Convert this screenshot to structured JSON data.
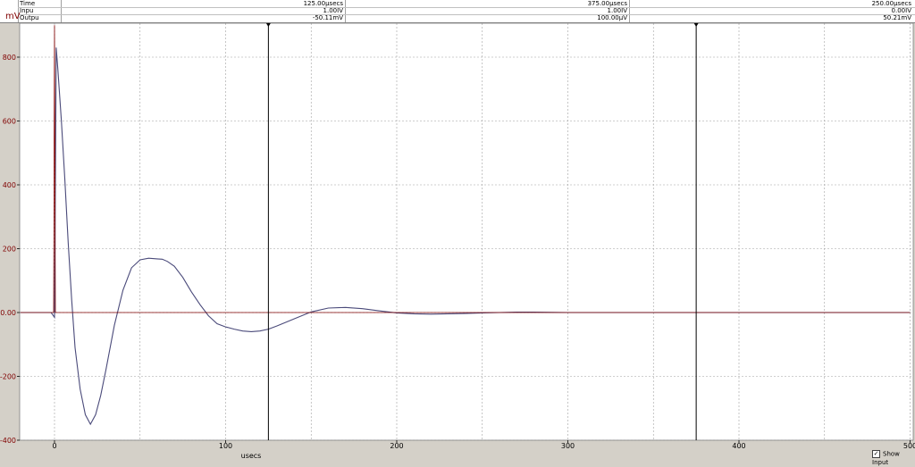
{
  "unit_label": "mV",
  "readout": {
    "rows": [
      {
        "name": "Time",
        "v1": "125.00µsecs",
        "v2": "375.00µsecs",
        "v3": "250.00µsecs"
      },
      {
        "name": "Inpu",
        "v1": "1.00IV",
        "v2": "1.00IV",
        "v3": "0.00IV"
      },
      {
        "name": "Outpu",
        "v1": "-50.11mV",
        "v2": "100.00µV",
        "v3": "50.21mV"
      }
    ]
  },
  "show_input": {
    "label": "Show Input",
    "checked": true,
    "mark": "✓"
  },
  "colors": {
    "plot_bg": "#ffffff",
    "grid": "#a0a0a0",
    "y_tick_label": "#800000",
    "trace_output": "#4a4a7a",
    "trace_input": "#800000",
    "cursor": "#000000"
  },
  "chart_data": {
    "type": "line",
    "xlabel": "usecs",
    "ylabel": "mV",
    "xlim": [
      -20,
      500
    ],
    "ylim": [
      -400,
      900
    ],
    "x_ticks": [
      0,
      100,
      200,
      300,
      400,
      500
    ],
    "x_tick_labels": [
      "0",
      "100",
      "200",
      "300",
      "400",
      "500"
    ],
    "y_ticks": [
      -400,
      -200,
      0,
      200,
      400,
      600,
      800
    ],
    "y_tick_labels": [
      "-400",
      "-200",
      "0.00",
      "200",
      "400",
      "600",
      "800"
    ],
    "grid": true,
    "cursors": [
      {
        "x": 125
      },
      {
        "x": 375
      }
    ],
    "series": [
      {
        "x": [
          -20,
          -2,
          0,
          0.5,
          1,
          2,
          4,
          6,
          8,
          10,
          12,
          15,
          18,
          21,
          24,
          27,
          30,
          35,
          40,
          45,
          50,
          55,
          60,
          63,
          66,
          70,
          75,
          80,
          85,
          90,
          95,
          100,
          105,
          110,
          115,
          120,
          125,
          130,
          140,
          150,
          160,
          170,
          180,
          190,
          200,
          210,
          220,
          230,
          240,
          250,
          260,
          270,
          280,
          300,
          350,
          400,
          500
        ],
        "y": [
          0,
          0,
          -15,
          400,
          830,
          760,
          600,
          420,
          220,
          40,
          -110,
          -240,
          -320,
          -350,
          -320,
          -260,
          -180,
          -40,
          70,
          140,
          165,
          170,
          168,
          167,
          160,
          145,
          110,
          65,
          25,
          -10,
          -35,
          -45,
          -52,
          -58,
          -60,
          -58,
          -52,
          -42,
          -20,
          2,
          14,
          16,
          12,
          5,
          -1,
          -4,
          -5,
          -4,
          -3,
          -1,
          0,
          1,
          1,
          0,
          0,
          0,
          0
        ]
      },
      {
        "x": [
          -20,
          -2,
          -0.5,
          0,
          0.5,
          500
        ],
        "y": [
          0,
          0,
          0,
          900,
          0,
          0
        ]
      }
    ]
  }
}
